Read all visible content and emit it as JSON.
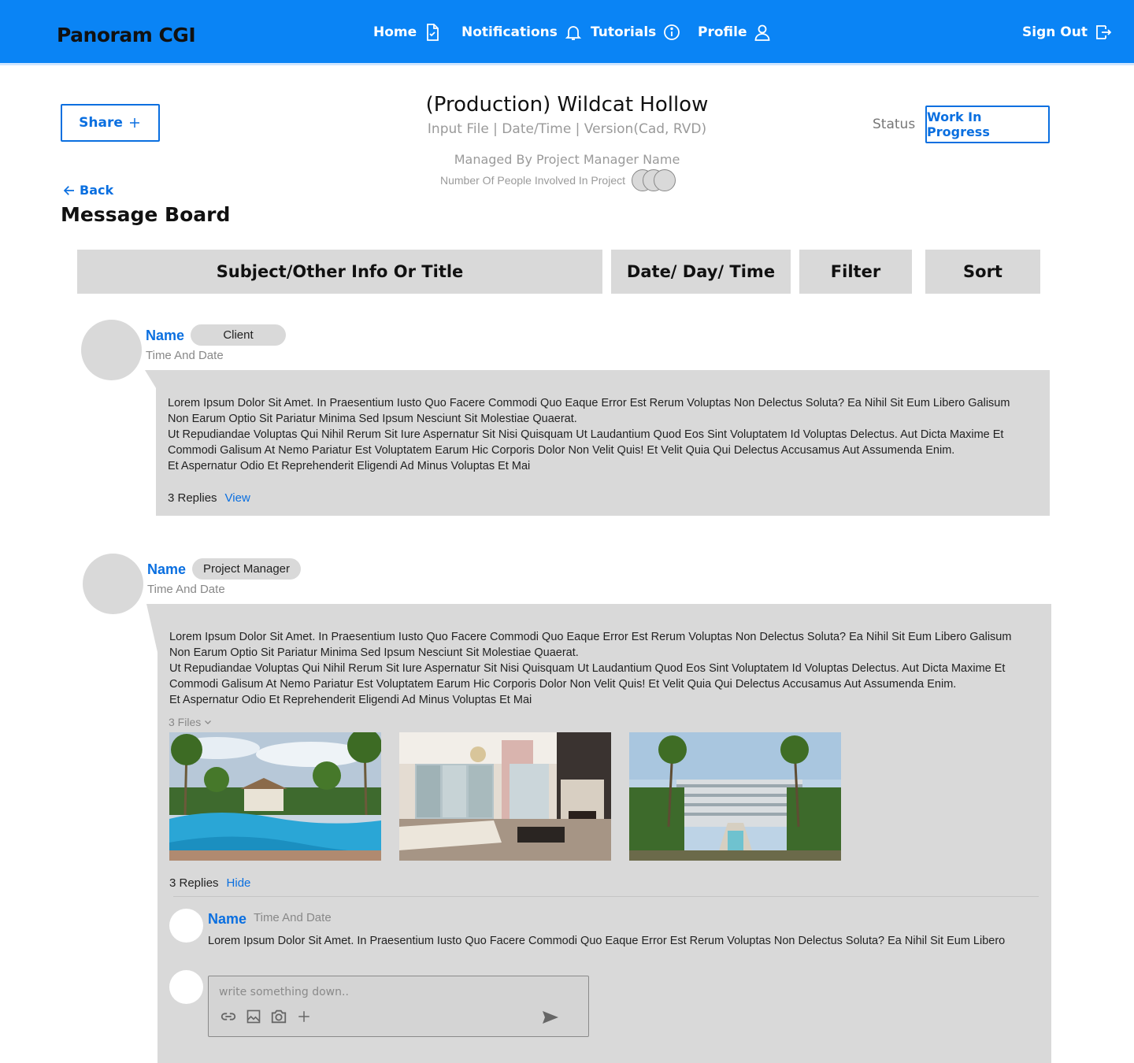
{
  "header": {
    "brand": "Panoram CGI",
    "nav": [
      {
        "label": "Home",
        "icon": "document-check-icon"
      },
      {
        "label": "Notifications",
        "icon": "bell-icon"
      },
      {
        "label": "Tutorials",
        "icon": "info-icon"
      },
      {
        "label": "Profile",
        "icon": "user-icon"
      }
    ],
    "sign_out": "Sign Out"
  },
  "project": {
    "share_label": "Share",
    "title": "(Production) Wildcat Hollow",
    "subtitle": "Input File | Date/Time | Version(Cad, RVD)",
    "managed_by": "Managed By Project Manager Name",
    "people_label": "Number Of People Involved In Project",
    "status_label": "Status",
    "status_value": "Work In Progress"
  },
  "board": {
    "back_label": "Back",
    "title": "Message Board",
    "columns": {
      "subject": "Subject/Other Info Or Title",
      "date": "Date/ Day/ Time",
      "filter": "Filter",
      "sort": "Sort"
    }
  },
  "messages": [
    {
      "name": "Name",
      "role": "Client",
      "time": "Time And Date",
      "lines": [
        "Lorem Ipsum Dolor Sit Amet. In Praesentium Iusto Quo Facere Commodi Quo Eaque Error Est Rerum Voluptas Non Delectus Soluta? Ea Nihil Sit Eum Libero Galisum",
        "Non Earum Optio Sit Pariatur Minima Sed Ipsum Nesciunt Sit Molestiae Quaerat.",
        "Ut Repudiandae Voluptas Qui Nihil Rerum Sit Iure Aspernatur Sit Nisi Quisquam Ut Laudantium Quod Eos Sint Voluptatem Id Voluptas Delectus. Aut Dicta Maxime Et",
        "Commodi Galisum At Nemo Pariatur Est Voluptatem Earum Hic Corporis Dolor Non Velit Quis! Et Velit Quia Qui Delectus Accusamus Aut Assumenda Enim.",
        "Et Aspernatur Odio Et Reprehenderit Eligendi Ad Minus Voluptas Et Mai"
      ],
      "replies_count": "3 Replies",
      "replies_action": "View"
    },
    {
      "name": "Name",
      "role": "Project Manager",
      "time": "Time And Date",
      "lines": [
        "Lorem Ipsum Dolor Sit Amet. In Praesentium Iusto Quo Facere Commodi Quo Eaque Error Est Rerum Voluptas Non Delectus Soluta? Ea Nihil Sit Eum Libero Galisum",
        "Non Earum Optio Sit Pariatur Minima Sed Ipsum Nesciunt Sit Molestiae Quaerat.",
        "Ut Repudiandae Voluptas Qui Nihil Rerum Sit Iure Aspernatur Sit Nisi Quisquam Ut Laudantium Quod Eos Sint Voluptatem Id Voluptas Delectus. Aut Dicta Maxime Et",
        "Commodi Galisum At Nemo Pariatur Est Voluptatem Earum Hic Corporis Dolor Non Velit Quis! Et Velit Quia Qui Delectus Accusamus Aut Assumenda Enim.",
        "Et Aspernatur Odio Et Reprehenderit Eligendi Ad Minus Voluptas Et Mai"
      ],
      "files_label": "3 Files",
      "files": [
        "pool-photo",
        "living-room-photo",
        "resort-courtyard-photo"
      ],
      "replies_count": "3 Replies",
      "replies_action": "Hide",
      "reply": {
        "name": "Name",
        "time": "Time And Date",
        "text": "Lorem Ipsum Dolor Sit Amet. In Praesentium Iusto Quo Facere Commodi Quo Eaque Error Est Rerum Voluptas Non Delectus Soluta? Ea Nihil Sit Eum Libero"
      },
      "composer": {
        "placeholder": "write something down..",
        "tools": [
          "link-icon",
          "image-icon",
          "camera-icon",
          "plus-icon"
        ],
        "send": "send-icon"
      }
    }
  ],
  "colors": {
    "header_bg": "#0a84f5",
    "accent": "#0a6fe0",
    "panel": "#d9d9d9"
  }
}
